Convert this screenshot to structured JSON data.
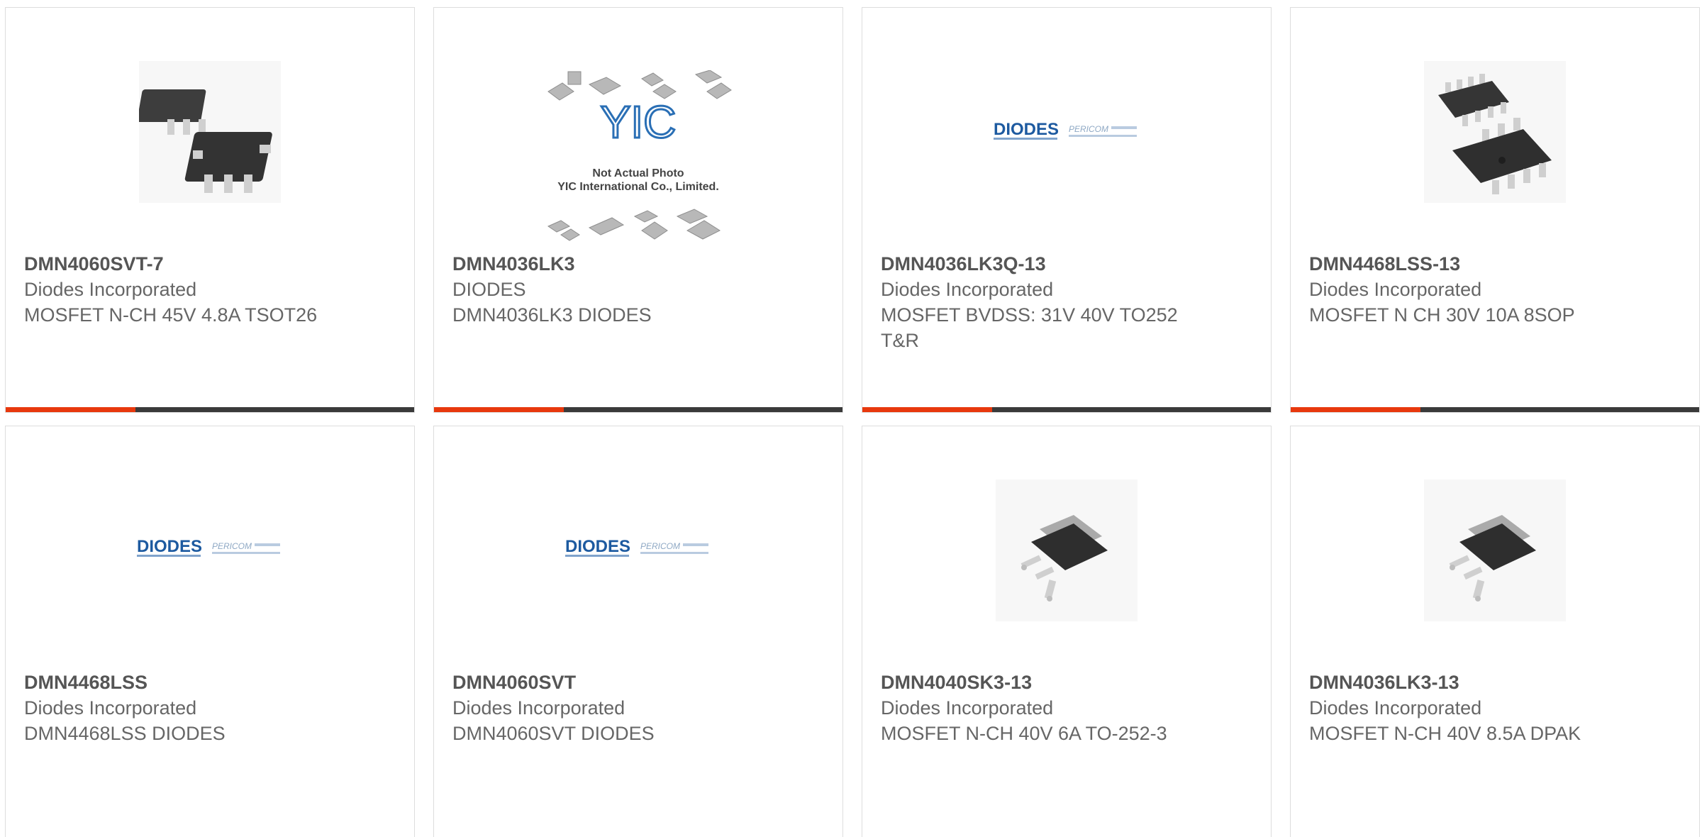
{
  "products": [
    {
      "part": "DMN4060SVT-7",
      "mfr": "Diodes Incorporated",
      "desc": "MOSFET N-CH 45V 4.8A TSOT26",
      "image": "sot-package-icon"
    },
    {
      "part": "DMN4036LK3",
      "mfr": "DIODES",
      "desc": "DMN4036LK3 DIODES",
      "image": "yic-placeholder-icon",
      "image_text": [
        "Not Actual Photo",
        "YIC International Co., Limited.",
        "YIC"
      ]
    },
    {
      "part": "DMN4036LK3Q-13",
      "mfr": "Diodes Incorporated",
      "desc": "MOSFET BVDSS: 31V 40V TO252 T&R",
      "image": "diodes-logo-icon",
      "image_text": [
        "DIODES",
        "PERICOM"
      ]
    },
    {
      "part": "DMN4468LSS-13",
      "mfr": "Diodes Incorporated",
      "desc": "MOSFET N CH 30V 10A 8SOP",
      "image": "soic-package-icon"
    },
    {
      "part": "DMN4468LSS",
      "mfr": "Diodes Incorporated",
      "desc": "DMN4468LSS DIODES",
      "image": "diodes-logo-icon",
      "image_text": [
        "DIODES",
        "PERICOM"
      ]
    },
    {
      "part": "DMN4060SVT",
      "mfr": "Diodes Incorporated",
      "desc": "DMN4060SVT DIODES",
      "image": "diodes-logo-icon",
      "image_text": [
        "DIODES",
        "PERICOM"
      ]
    },
    {
      "part": "DMN4040SK3-13",
      "mfr": "Diodes Incorporated",
      "desc": "MOSFET N-CH 40V 6A TO-252-3",
      "image": "dpak-package-icon"
    },
    {
      "part": "DMN4036LK3-13",
      "mfr": "Diodes Incorporated",
      "desc": "MOSFET N-CH 40V 8.5A DPAK",
      "image": "dpak-package-icon"
    }
  ],
  "colors": {
    "accent": "#e8380d",
    "bar": "#3a3a3a",
    "border": "#dddddd",
    "text": "#666666",
    "diodes_blue": "#1d5aa0"
  }
}
